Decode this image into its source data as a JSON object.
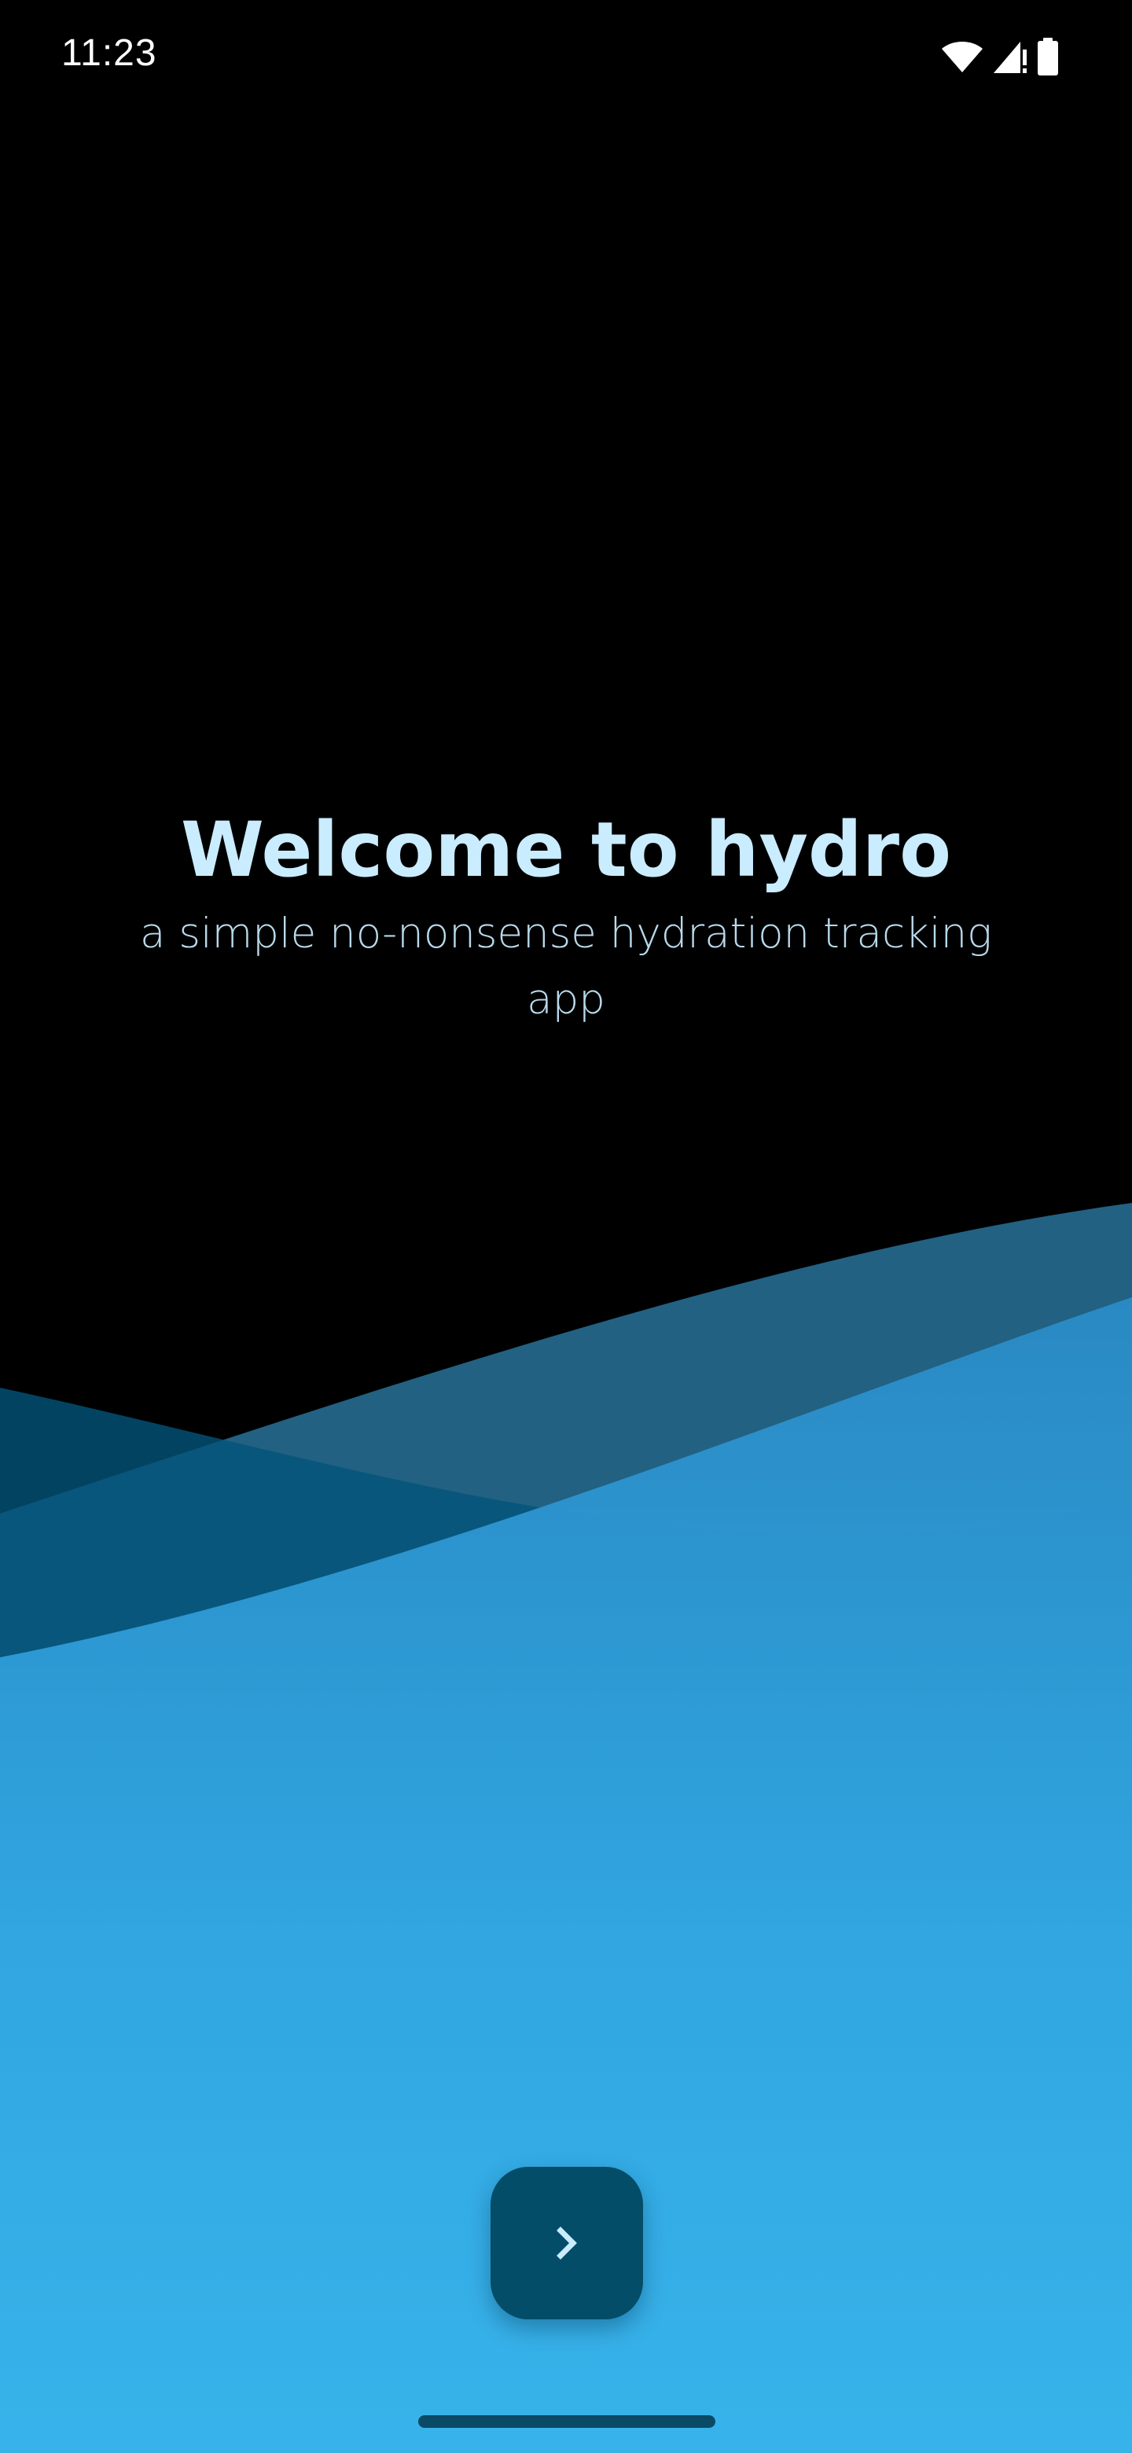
{
  "status_bar": {
    "time": "11:23",
    "icons": [
      "wifi-icon",
      "cellular-signal-icon",
      "battery-icon"
    ]
  },
  "welcome": {
    "title": "Welcome to hydro",
    "subtitle": "a simple no-nonsense hydration tracking app"
  },
  "next_button": {
    "icon": "chevron-right-icon"
  },
  "colors": {
    "background": "#000000",
    "text_accent": "#c9ecff",
    "button": "#034d69",
    "wave_deep": "#04547a",
    "wave_mid": "#2a7aa0",
    "wave_light": "#3ab6ee"
  }
}
